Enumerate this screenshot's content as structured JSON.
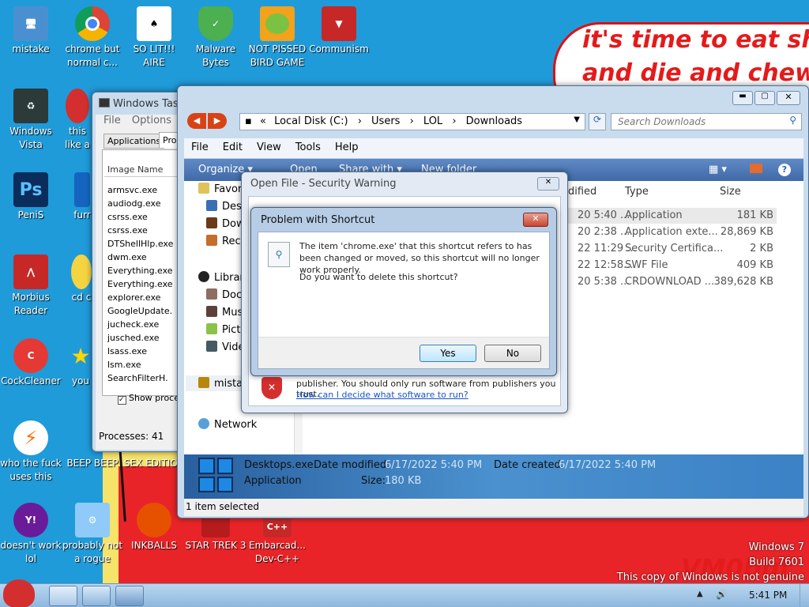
{
  "desktop": {
    "speech_line1": "it's time to eat shit",
    "speech_line2": "and die and chew",
    "art_signature": "VM0but",
    "watermark": {
      "line1": "Windows 7",
      "line2": "Build 7601",
      "line3": "This copy of Windows is not genuine"
    },
    "icons": [
      {
        "label": "mistake",
        "icon": "computer-icon"
      },
      {
        "label": "chrome but normal c...",
        "icon": "chrome-icon"
      },
      {
        "label": "SO LIT!!! AIRE",
        "icon": "cards-icon"
      },
      {
        "label": "Malware Bytes",
        "icon": "shield-icon"
      },
      {
        "label": "NOT PISSED BIRD GAME",
        "icon": "pig-icon"
      },
      {
        "label": "Communism",
        "icon": "flag-icon"
      },
      {
        "label": "Windows Vista",
        "icon": "recycle-bin-icon"
      },
      {
        "label": "this like a",
        "icon": "app-icon"
      },
      {
        "label": "PeniS",
        "icon": "photoshop-icon"
      },
      {
        "label": "furr",
        "icon": "app-icon"
      },
      {
        "label": "Morbius Reader",
        "icon": "pdf-icon"
      },
      {
        "label": "cd c",
        "icon": "cd-icon"
      },
      {
        "label": "CockCleaner",
        "icon": "ccleaner-icon"
      },
      {
        "label": "you",
        "icon": "star-icon"
      },
      {
        "label": "who the fuck uses this",
        "icon": "winamp-icon"
      },
      {
        "label": "BEEP BEEP",
        "icon": "app-icon"
      },
      {
        "label": "SEX EDITIOR",
        "icon": "app-icon"
      },
      {
        "label": "doesn't work lol",
        "icon": "yahoo-icon"
      },
      {
        "label": "probably not a rogue",
        "icon": "gears-icon"
      },
      {
        "label": "INKBALLS",
        "icon": "inkball-icon"
      },
      {
        "label": "STAR TREK 3",
        "icon": "startrek-icon"
      },
      {
        "label": "Embarcad... Dev-C++",
        "icon": "devcpp-icon"
      }
    ]
  },
  "explorer": {
    "path": {
      "prefix": "«",
      "seg1": "Local Disk (C:)",
      "seg2": "Users",
      "seg3": "LOL",
      "seg4": "Downloads"
    },
    "search_placeholder": "Search Downloads",
    "menu": [
      "File",
      "Edit",
      "View",
      "Tools",
      "Help"
    ],
    "commands": {
      "organize": "Organize ▾",
      "open": "Open",
      "share": "Share with ▾",
      "new_folder": "New folder"
    },
    "columns": {
      "modified": "dified",
      "type": "Type",
      "size": "Size"
    },
    "nav": {
      "favorites": "Favor",
      "desktop": "Des",
      "downloads": "Dow",
      "recent": "Rec",
      "libraries": "Librar",
      "documents": "Doc",
      "music": "Mus",
      "pictures": "Pict",
      "videos": "Vide",
      "computer": "mista",
      "network": "Network"
    },
    "files": [
      {
        "modified": "20 5:40 ...",
        "type": "Application",
        "size": "181 KB"
      },
      {
        "modified": "20 2:38 ...",
        "type": "Application exte...",
        "size": "28,869 KB"
      },
      {
        "modified": "22 11:29 ...",
        "type": "Security Certifica...",
        "size": "2 KB"
      },
      {
        "modified": "22 12:58...",
        "type": "SWF File",
        "size": "409 KB"
      },
      {
        "modified": "20 5:38 ...",
        "type": "CRDOWNLOAD ...",
        "size": "389,628 KB"
      }
    ],
    "details": {
      "name": "Desktops.exe",
      "modified_label": "Date modified:",
      "modified": "6/17/2022 5:40 PM",
      "created_label": "Date created:",
      "created": "6/17/2022 5:40 PM",
      "type": "Application",
      "size_label": "Size:",
      "size": "180 KB"
    },
    "status": "1 item selected"
  },
  "taskmgr": {
    "title": "Windows Task",
    "menu": [
      "File",
      "Options"
    ],
    "tabs": [
      "Applications",
      "Proc"
    ],
    "column": "Image Name",
    "processes": [
      "armsvc.exe",
      "audiodg.exe",
      "csrss.exe",
      "csrss.exe",
      "DTShellHlp.exe",
      "dwm.exe",
      "Everything.exe",
      "Everything.exe",
      "explorer.exe",
      "GoogleUpdate.",
      "jucheck.exe",
      "jusched.exe",
      "lsass.exe",
      "lsm.exe",
      "SearchFilterH."
    ],
    "show_processes": "Show proces",
    "footer": "Processes: 41"
  },
  "secwarn": {
    "title": "Open File - Security Warning",
    "body": "publisher.  You should only run software from publishers you trust.",
    "link": "How can I decide what software to run?"
  },
  "problem": {
    "title": "Problem with Shortcut",
    "message": "The item 'chrome.exe' that this shortcut refers to has been changed or moved, so this shortcut will no longer work properly.",
    "question": "Do you want to delete this shortcut?",
    "yes": "Yes",
    "no": "No"
  },
  "taskbar": {
    "time": "5:41 PM"
  }
}
